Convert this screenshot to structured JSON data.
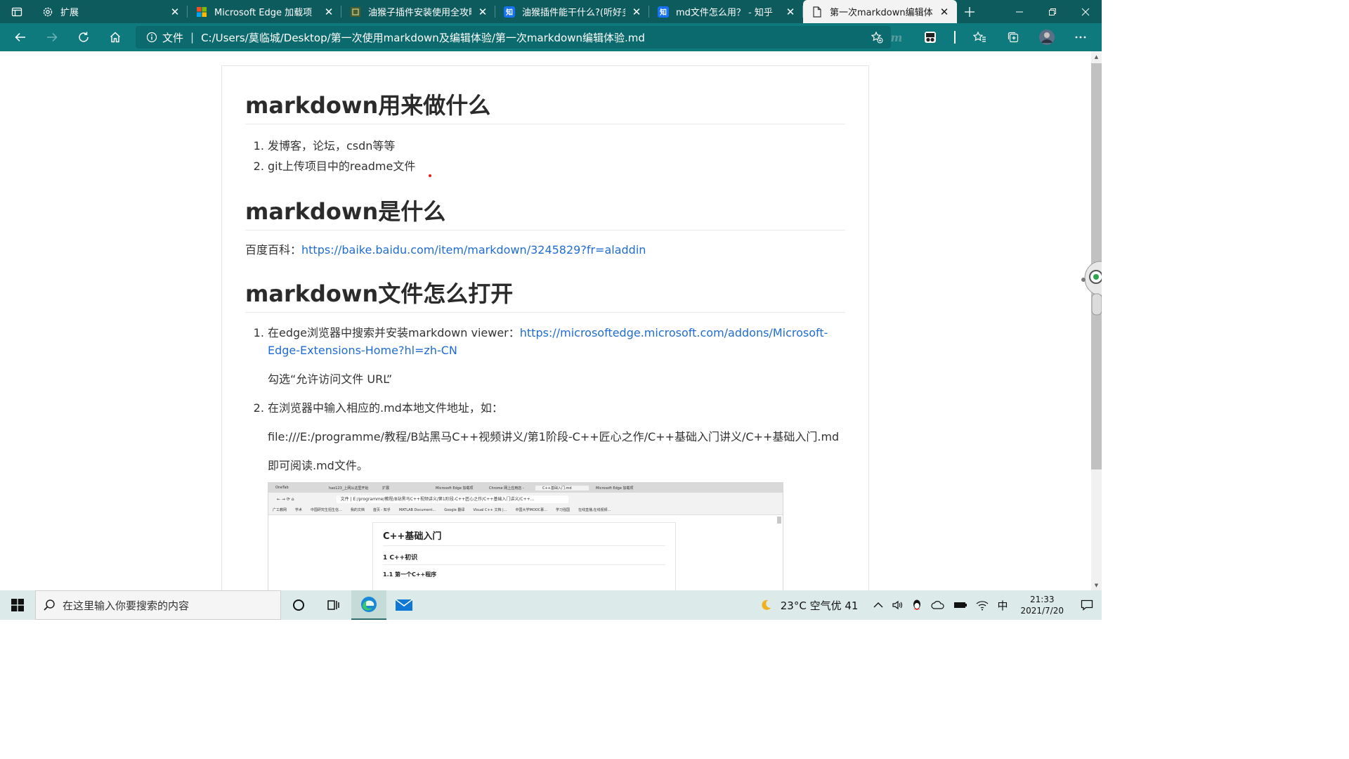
{
  "browser": {
    "tabs": [
      {
        "title": "扩展",
        "icon": "gear-icon",
        "active": false
      },
      {
        "title": "Microsoft Edge 加载项",
        "icon": "microsoft-icon",
        "active": false
      },
      {
        "title": "油猴子插件安装使用全攻略",
        "icon": "greenbox-icon",
        "active": false
      },
      {
        "title": "油猴插件能干什么?(听好多人",
        "icon": "zhihu-icon",
        "active": false
      },
      {
        "title": "md文件怎么用？ - 知乎",
        "icon": "zhihu-icon",
        "active": false
      },
      {
        "title": "第一次markdown编辑体验.m",
        "icon": "document-icon",
        "active": true
      }
    ],
    "address": {
      "label": "文件",
      "url": "C:/Users/莫临城/Desktop/第一次使用markdown及编辑体验/第一次markdown编辑体验.md"
    },
    "zhihu_favicon_text": "知"
  },
  "document": {
    "section1": {
      "heading": "markdown用来做什么",
      "items": [
        "发博客，论坛，csdn等等",
        "git上传项目中的readme文件"
      ]
    },
    "section2": {
      "heading": "markdown是什么",
      "prefix": "百度百科：",
      "link": "https://baike.baidu.com/item/markdown/3245829?fr=aladdin"
    },
    "section3": {
      "heading": "markdown文件怎么打开",
      "step1_text": "在edge浏览器中搜索并安装markdown viewer：",
      "step1_link": "https://microsoftedge.microsoft.com/addons/Microsoft-Edge-Extensions-Home?hl=zh-CN",
      "step1_note": "勾选“允许访问文件 URL”",
      "step2_text": "在浏览器中输入相应的.md本地文件地址，如：",
      "step2_path": "file:///E:/programme/教程/B站黑马C++视频讲义/第1阶段-C++匠心之作/C++基础入门讲义/C++基础入门.md",
      "step2_after": "即可阅读.md文件。"
    },
    "embedded_screenshot": {
      "tabs": [
        "OneTab",
        "hao123_上网从这里开始",
        "扩展",
        "Microsoft Edge 加载项",
        "Chrome 网上应用店 -",
        "C++基础入门.md",
        "Microsoft Edge 加载项"
      ],
      "url_label": "文件",
      "url": "E:/programme/教程/B站黑马C++视频讲义/第1阶段-C++匠心之作/C++基础入门讲义/C++...",
      "bookmarks": [
        "广工教网",
        "学术",
        "中国研究生招生信...",
        "我的文档",
        "首页 - 知乎",
        "MATLAB Document...",
        "Google 翻译",
        "Visual C++ 文档 |...",
        "中国大学MOOC慕...",
        "学习强国",
        "在线直播,在线视频..."
      ],
      "h1": "C++基础入门",
      "h2": "1 C++初识",
      "h3": "1.1 第一个C++程序"
    }
  },
  "taskbar": {
    "search_placeholder": "在这里输入你要搜索的内容",
    "weather": "23°C  空气优 41",
    "ime": "中",
    "time": "21:33",
    "date": "2021/7/20"
  },
  "colors": {
    "tab_strip": "#0e5b5e",
    "toolbar": "#0e7a7e",
    "link": "#1f6cd4",
    "taskbar": "#dcebe9"
  }
}
